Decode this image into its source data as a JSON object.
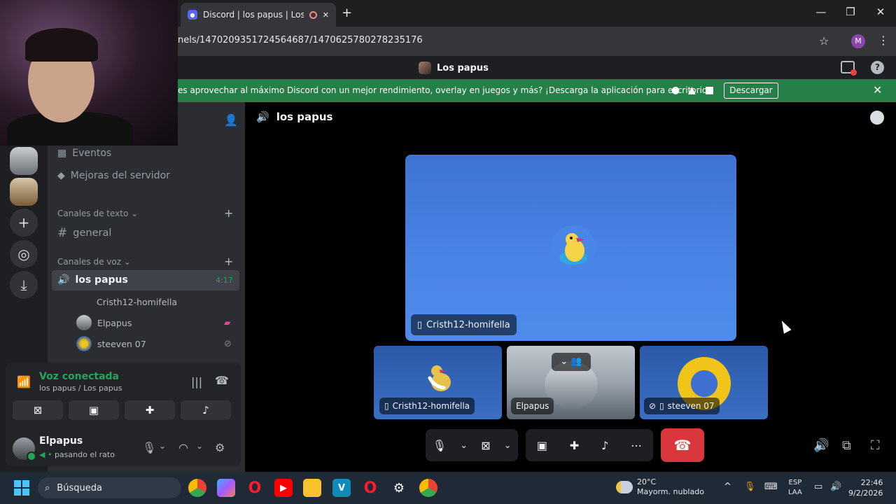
{
  "browser": {
    "tab_title": "Discord | los papus | Los papus",
    "new_tab": "+",
    "url": "nels/1470209351724564687/1470625780278235176",
    "profile_initial": "M",
    "win_min": "—",
    "win_restore": "❐",
    "win_close": "✕"
  },
  "titlebar": {
    "server_name": "Los papus"
  },
  "notice": {
    "text": "es aprovechar al máximo Discord con un mejor rendimiento, overlay en juegos y más? ¡Descarga la aplicación para escritorio!",
    "download_label": "Descargar",
    "close": "✕"
  },
  "sidebar": {
    "events_label": "Eventos",
    "boosts_label": "Mejoras del servidor",
    "text_category": "Canales de texto",
    "text_channels": [
      {
        "name": "general"
      }
    ],
    "voice_category": "Canales de voz",
    "voice_channel": {
      "name": "los papus",
      "timer": "4:17"
    },
    "voice_members": [
      {
        "name": "Cristh12-homifella"
      },
      {
        "name": "Elpapus"
      },
      {
        "name": "steeven 07"
      }
    ]
  },
  "voice_panel": {
    "status": "Voz conectada",
    "location": "los papus / Los papus"
  },
  "user_panel": {
    "name": "Elpapus",
    "status": "pasando el rato"
  },
  "stage": {
    "channel_name": "los papus",
    "main_tile_name": "Cristh12-homifella",
    "tiles": [
      {
        "name": "Cristh12-homifella"
      },
      {
        "name": "Elpapus"
      },
      {
        "name": "steeven 07"
      }
    ]
  },
  "taskbar": {
    "search_placeholder": "Búsqueda",
    "weather_temp": "20°C",
    "weather_desc": "Mayorm. nublado",
    "lang_top": "ESP",
    "lang_bottom": "LAA",
    "time": "22:46",
    "date": "9/2/2026"
  },
  "colors": {
    "accent_green": "#23a55a",
    "hangup_red": "#da373c",
    "notice_green": "#248046",
    "blurple": "#5865f2"
  }
}
